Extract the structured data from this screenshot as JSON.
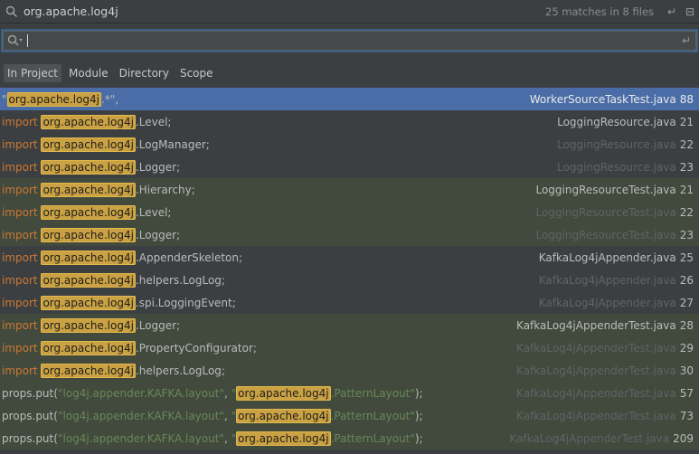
{
  "search": {
    "query": "org.apache.log4j",
    "match_count": "25 matches in 8 files",
    "filter_value": ""
  },
  "scopes": [
    {
      "label": "In Project",
      "active": true
    },
    {
      "label": "Module"
    },
    {
      "label": "Directory"
    },
    {
      "label": "Scope"
    }
  ],
  "results": [
    {
      "prefix": "\"",
      "match": "org.apache.log4j",
      "suffix": ".*\",",
      "file": "WorkerSourceTaskTest.java",
      "line": "88"
    },
    {
      "prefix_kw": "import ",
      "match": "org.apache.log4j",
      "suffix": ".Level;",
      "file": "LoggingResource.java",
      "line": "21"
    },
    {
      "prefix_kw": "import ",
      "match": "org.apache.log4j",
      "suffix": ".LogManager;",
      "file": "LoggingResource.java",
      "line": "22"
    },
    {
      "prefix_kw": "import ",
      "match": "org.apache.log4j",
      "suffix": ".Logger;",
      "file": "LoggingResource.java",
      "line": "23"
    },
    {
      "prefix_kw": "import ",
      "match": "org.apache.log4j",
      "suffix": ".Hierarchy;",
      "file": "LoggingResourceTest.java",
      "line": "21"
    },
    {
      "prefix_kw": "import ",
      "match": "org.apache.log4j",
      "suffix": ".Level;",
      "file": "LoggingResourceTest.java",
      "line": "22"
    },
    {
      "prefix_kw": "import ",
      "match": "org.apache.log4j",
      "suffix": ".Logger;",
      "file": "LoggingResourceTest.java",
      "line": "23"
    },
    {
      "prefix_kw": "import ",
      "match": "org.apache.log4j",
      "suffix": ".AppenderSkeleton;",
      "file": "KafkaLog4jAppender.java",
      "line": "25"
    },
    {
      "prefix_kw": "import ",
      "match": "org.apache.log4j",
      "suffix": ".helpers.LogLog;",
      "file": "KafkaLog4jAppender.java",
      "line": "26"
    },
    {
      "prefix_kw": "import ",
      "match": "org.apache.log4j",
      "suffix": ".spi.LoggingEvent;",
      "file": "KafkaLog4jAppender.java",
      "line": "27"
    },
    {
      "prefix_kw": "import ",
      "match": "org.apache.log4j",
      "suffix": ".Logger;",
      "file": "KafkaLog4jAppenderTest.java",
      "line": "28"
    },
    {
      "prefix_kw": "import ",
      "match": "org.apache.log4j",
      "suffix": ".PropertyConfigurator;",
      "file": "KafkaLog4jAppenderTest.java",
      "line": "29"
    },
    {
      "prefix_kw": "import ",
      "match": "org.apache.log4j",
      "suffix": ".helpers.LogLog;",
      "file": "KafkaLog4jAppenderTest.java",
      "line": "30"
    },
    {
      "prefix": "props.put(",
      "str1": "\"log4j.appender.KAFKA.layout\"",
      "mid": ", ",
      "str2": "\"",
      "match": "org.apache.log4j",
      "str3": ".PatternLayout\"",
      "suffix": ");",
      "file": "KafkaLog4jAppenderTest.java",
      "line": "57"
    },
    {
      "prefix": "props.put(",
      "str1": "\"log4j.appender.KAFKA.layout\"",
      "mid": ", ",
      "str2": "\"",
      "match": "org.apache.log4j",
      "str3": ".PatternLayout\"",
      "suffix": ");",
      "file": "KafkaLog4jAppenderTest.java",
      "line": "73"
    },
    {
      "prefix": "props.put(",
      "str1": "\"log4j.appender.KAFKA.layout\"",
      "mid": ", ",
      "str2": "\"",
      "match": "org.apache.log4j",
      "str3": ".PatternLayout\"",
      "suffix": ");",
      "file": "KafkaLog4jAppenderTest.java",
      "line": "209"
    }
  ],
  "colors": {
    "selection": "#4a6da7",
    "highlight": "#cba243",
    "keyword": "#cc7832",
    "string": "#6a8759"
  },
  "icons": {
    "search": "search-icon",
    "pin": "pin-icon",
    "filter_options": "filter-icon",
    "enter": "enter-icon"
  }
}
